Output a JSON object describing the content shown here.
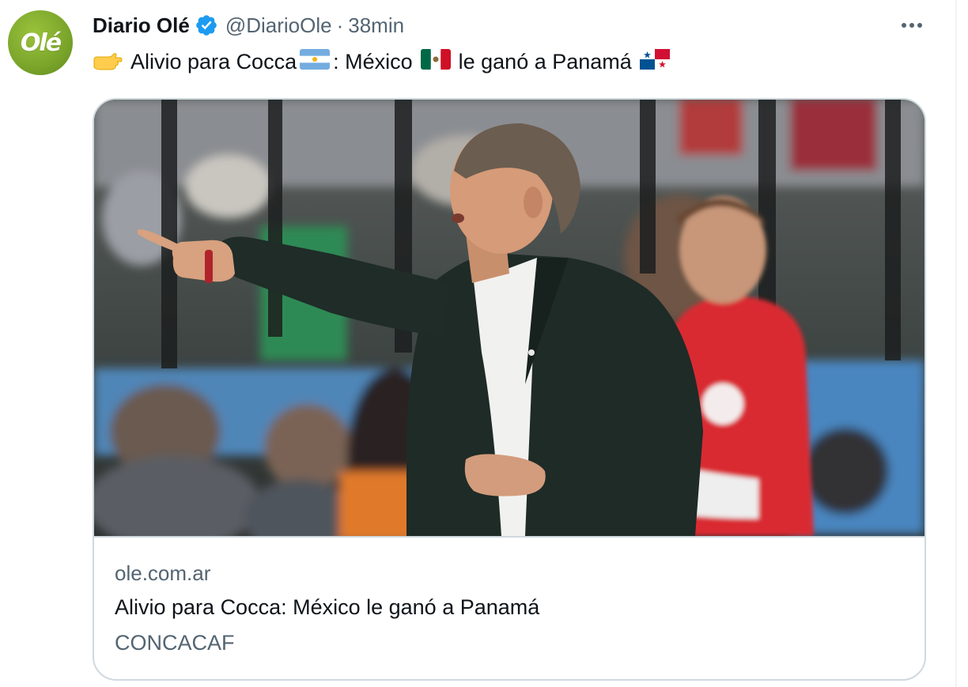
{
  "author": {
    "display_name": "Diario Olé",
    "handle": "@DiarioOle",
    "separator": "·",
    "time": "38min",
    "avatar_text": "Olé",
    "verified": true
  },
  "tweet": {
    "emoji_lead": "pointing-right-hand-emoji",
    "text_part1": "Alivio para Cocca",
    "flag1": "argentina-flag",
    "text_part2": ": México",
    "flag2": "mexico-flag",
    "text_part3": "le ganó a Panamá",
    "flag3": "panama-flag"
  },
  "card": {
    "image_alt": "Photo of a coach in a dark suit pointing from the sideline",
    "domain": "ole.com.ar",
    "title": "Alivio para Cocca: México le ganó a Panamá",
    "description": "CONCACAF"
  },
  "colors": {
    "text_primary": "#0f1419",
    "text_secondary": "#536471",
    "verified_blue": "#1d9bf0",
    "card_border": "#cfd9de",
    "avatar_green": "#7aa52a"
  }
}
